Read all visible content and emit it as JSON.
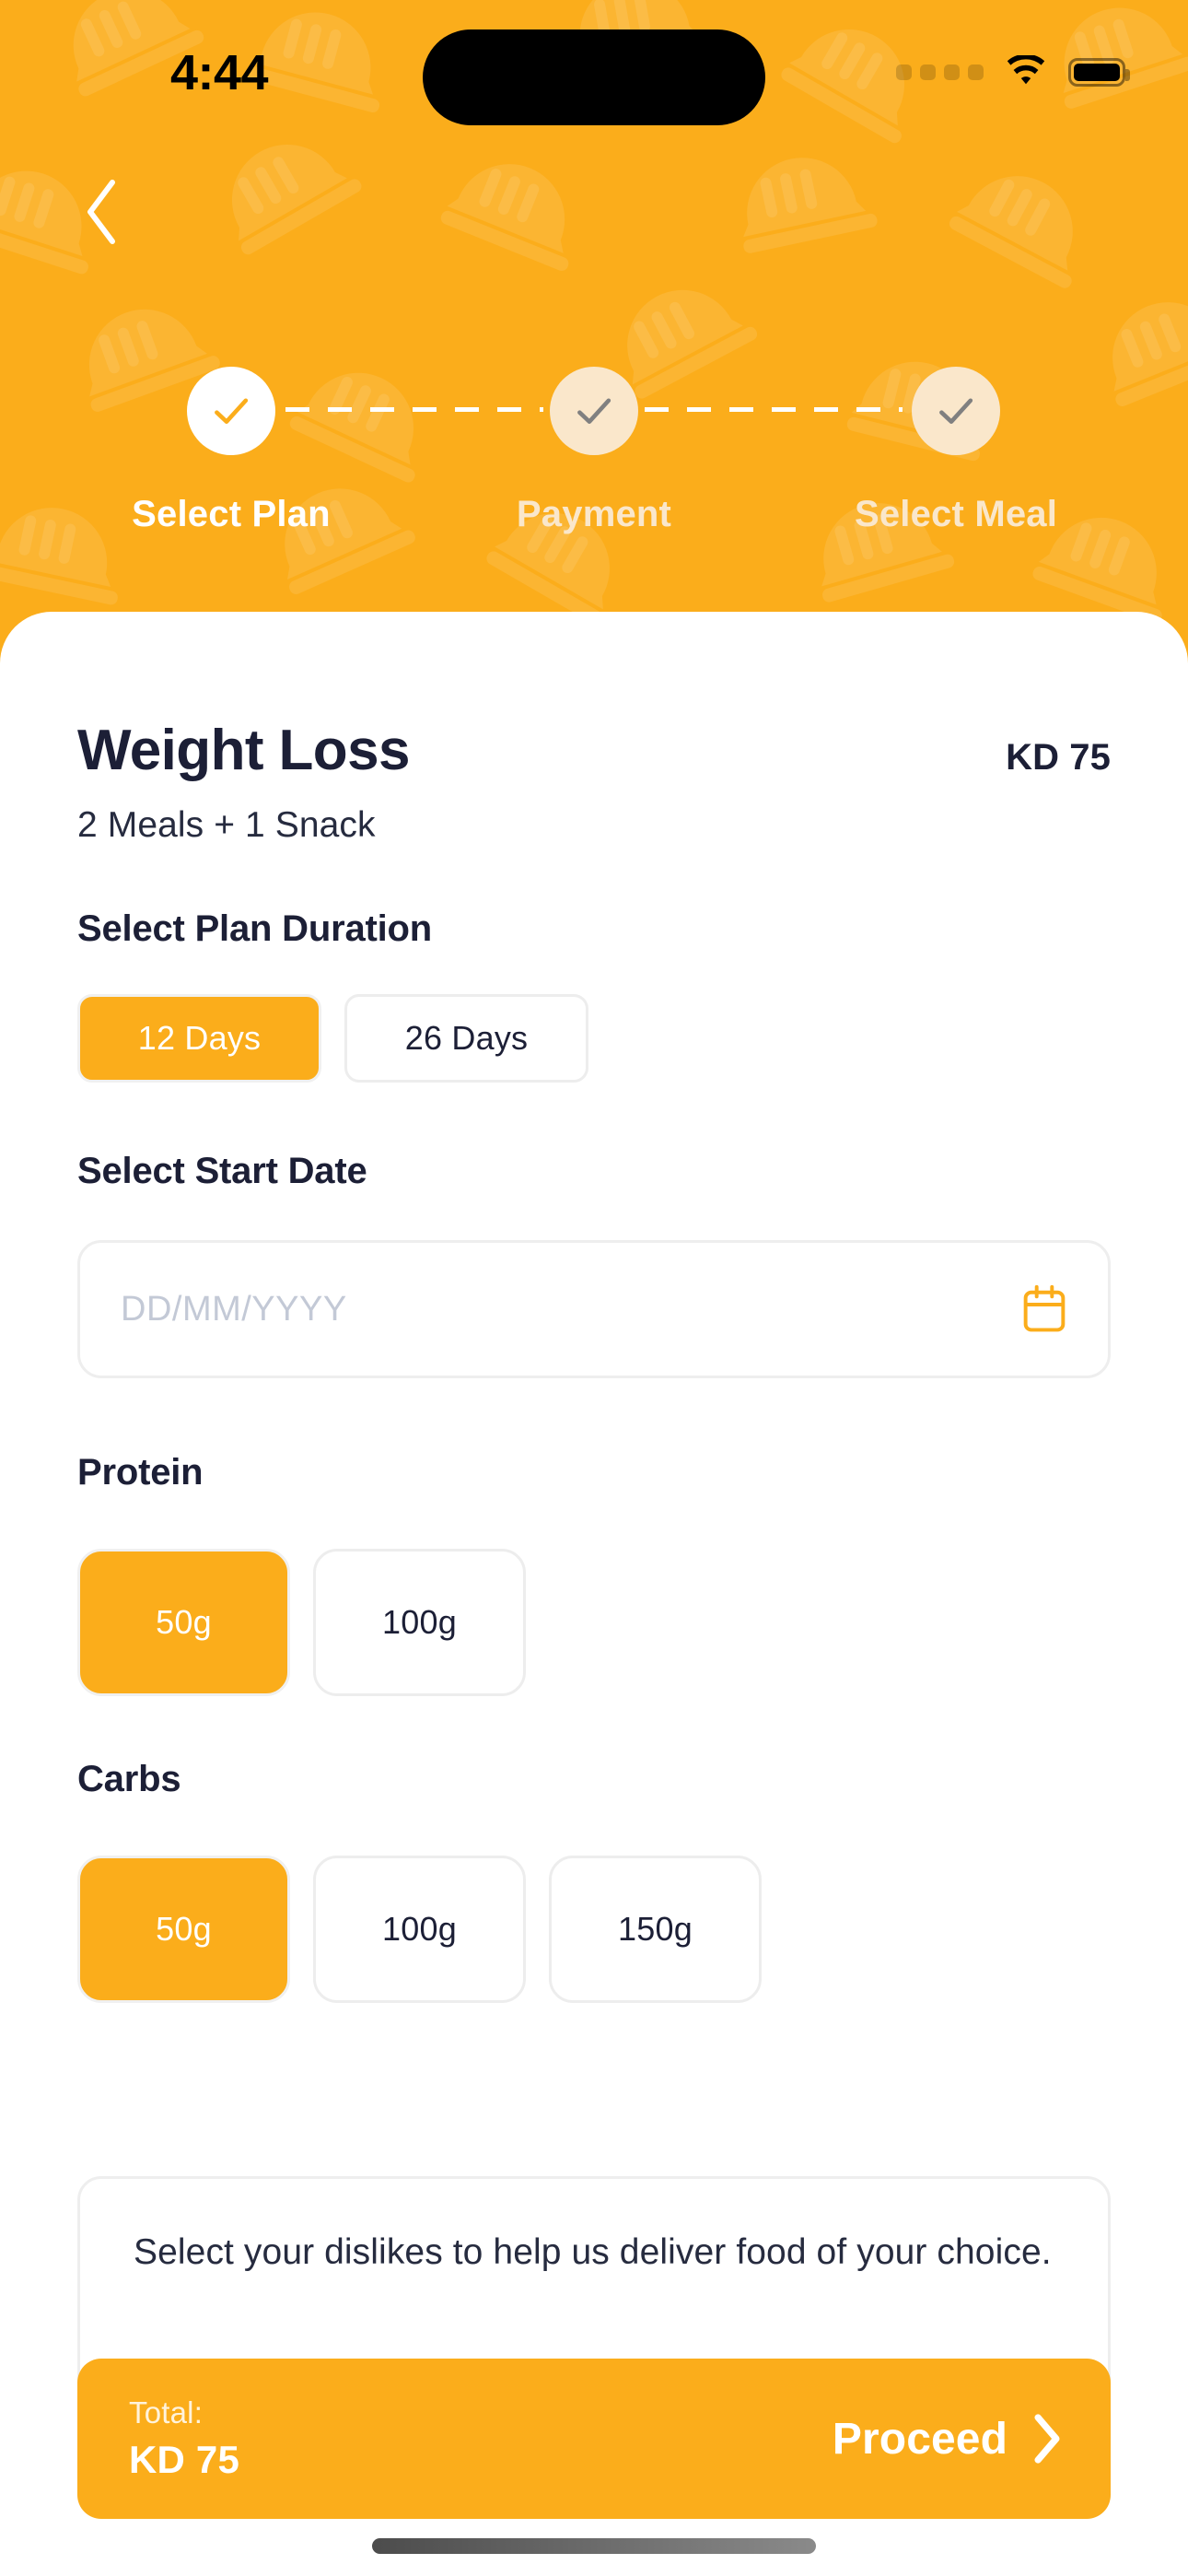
{
  "status_bar": {
    "time": "4:44",
    "signal_icon": "signal-dots-icon",
    "wifi_icon": "wifi-icon",
    "battery_icon": "battery-icon"
  },
  "header": {
    "back_icon": "chevron-left-icon",
    "background_color": "#FBAD1B",
    "steps": [
      {
        "label": "Select Plan",
        "state": "active",
        "check_icon": "check-icon",
        "check_color": "#FBAD1B",
        "circle_color": "#FFFFFF"
      },
      {
        "label": "Payment",
        "state": "inactive",
        "check_icon": "check-icon",
        "check_color": "#808080",
        "circle_color": "#FAE7CB"
      },
      {
        "label": "Select Meal",
        "state": "inactive",
        "check_icon": "check-icon",
        "check_color": "#808080",
        "circle_color": "#FAE7CB"
      }
    ]
  },
  "plan": {
    "title": "Weight Loss",
    "price": "KD 75",
    "subtitle": "2 Meals + 1 Snack"
  },
  "duration": {
    "label": "Select Plan Duration",
    "options": [
      {
        "label": "12 Days",
        "selected": true
      },
      {
        "label": "26 Days",
        "selected": false
      }
    ]
  },
  "start_date": {
    "label": "Select Start Date",
    "value": "",
    "placeholder": "DD/MM/YYYY",
    "calendar_icon": "calendar-icon",
    "icon_color": "#FBAD1B"
  },
  "protein": {
    "label": "Protein",
    "options": [
      {
        "label": "50g",
        "selected": true
      },
      {
        "label": "100g",
        "selected": false
      }
    ]
  },
  "carbs": {
    "label": "Carbs",
    "options": [
      {
        "label": "50g",
        "selected": true
      },
      {
        "label": "100g",
        "selected": false
      },
      {
        "label": "150g",
        "selected": false
      }
    ]
  },
  "dislikes": {
    "text": "Select your dislikes to help us deliver food of your choice."
  },
  "bottom_bar": {
    "total_label": "Total:",
    "total_value": "KD 75",
    "proceed_label": "Proceed",
    "proceed_icon": "chevron-right-icon",
    "background_color": "#FBAD1B"
  }
}
